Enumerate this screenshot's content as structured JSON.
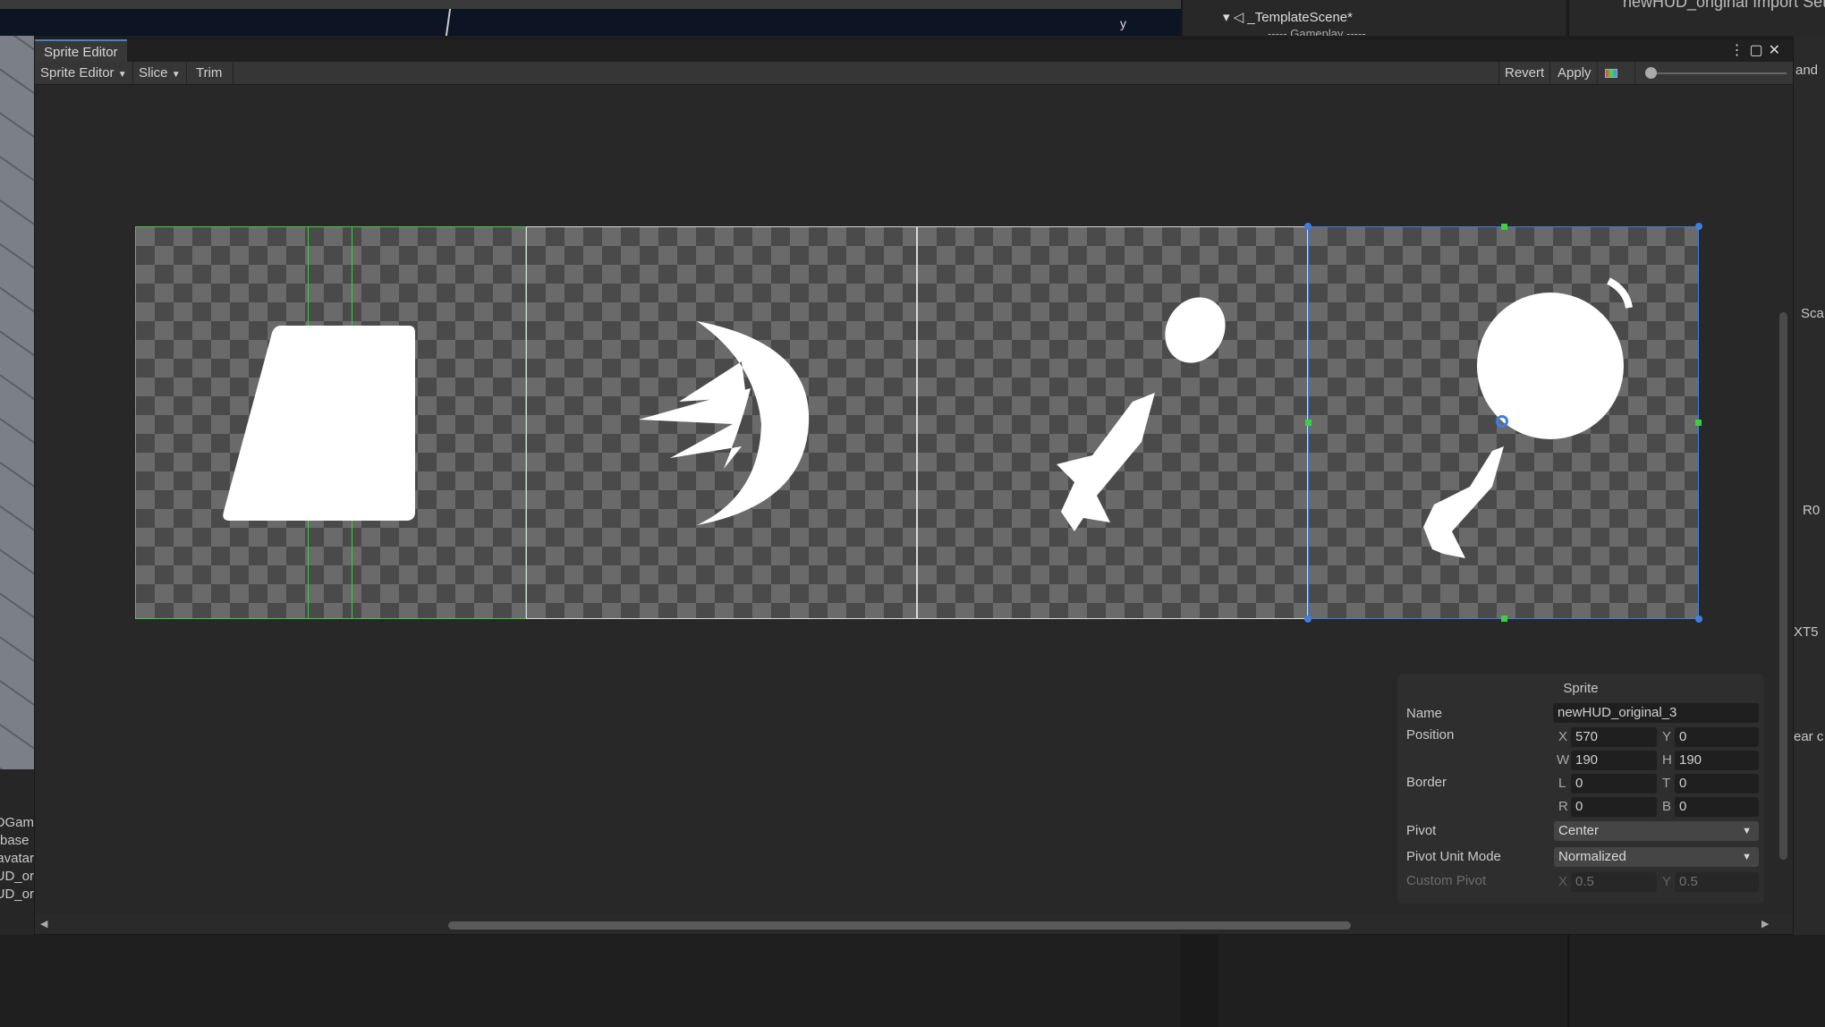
{
  "hierarchy": {
    "scene": "_TemplateScene*",
    "child": "----- Gameplay -----"
  },
  "inspector": {
    "title": "newHUD_original Import Settings"
  },
  "left_panel": {
    "items": [
      "DGam",
      "base",
      "avatar",
      "UD_or",
      "UD_or"
    ]
  },
  "right_panel": {
    "items": [
      "Sca",
      "R0",
      "XT5",
      "ear c",
      "and"
    ]
  },
  "window": {
    "tab": "Sprite Editor"
  },
  "toolbar": {
    "mode": "Sprite Editor",
    "slice": "Slice",
    "trim": "Trim",
    "revert": "Revert",
    "apply": "Apply"
  },
  "sprite_panel": {
    "title": "Sprite",
    "name_label": "Name",
    "name": "newHUD_original_3",
    "position_label": "Position",
    "x": "570",
    "y": "0",
    "w": "190",
    "h": "190",
    "border_label": "Border",
    "l": "0",
    "t": "0",
    "r": "0",
    "b": "0",
    "pivot_label": "Pivot",
    "pivot": "Center",
    "pivot_unit_label": "Pivot Unit Mode",
    "pivot_unit": "Normalized",
    "custom_pivot_label": "Custom Pivot",
    "cx": "0.5",
    "cy": "0.5",
    "axis": {
      "x": "X",
      "y": "Y",
      "w": "W",
      "h": "H",
      "l": "L",
      "t": "T",
      "r": "R",
      "b": "B"
    }
  },
  "colors": {
    "selection": "#3d7fe0",
    "outline": "#3dcf3d",
    "accent": "#4a7fc0"
  }
}
